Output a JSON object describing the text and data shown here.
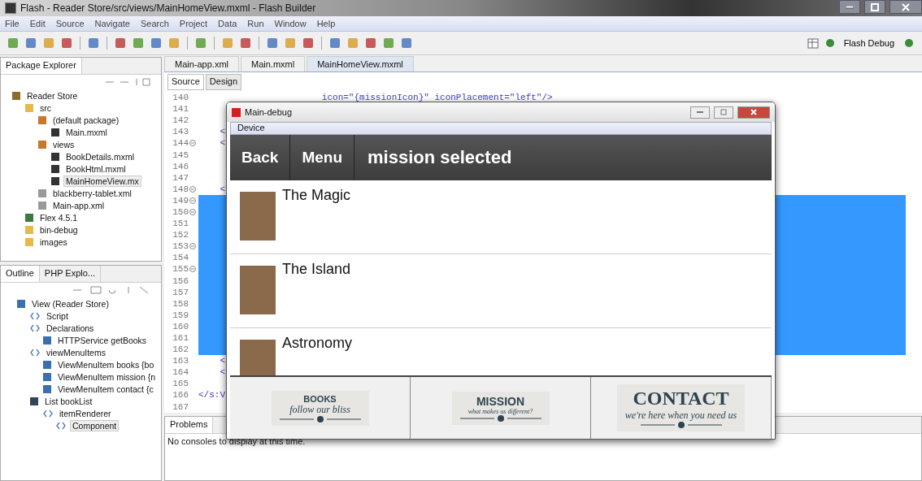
{
  "window": {
    "title": "Flash - Reader Store/src/views/MainHomeView.mxml - Flash Builder"
  },
  "menu": [
    "File",
    "Edit",
    "Source",
    "Navigate",
    "Search",
    "Project",
    "Data",
    "Run",
    "Window",
    "Help"
  ],
  "perspective": {
    "label": "Flash Debug"
  },
  "package_explorer": {
    "title": "Package Explorer",
    "tree": [
      {
        "label": "Reader Store",
        "kind": "project",
        "selected": false,
        "children": [
          {
            "label": "src",
            "kind": "folder",
            "selected": false,
            "children": [
              {
                "label": "(default package)",
                "kind": "package",
                "selected": false,
                "children": [
                  {
                    "label": "Main.mxml",
                    "kind": "mxml",
                    "selected": false
                  }
                ]
              },
              {
                "label": "views",
                "kind": "package",
                "selected": false,
                "children": [
                  {
                    "label": "BookDetails.mxml",
                    "kind": "mxml",
                    "selected": false
                  },
                  {
                    "label": "BookHtml.mxml",
                    "kind": "mxml",
                    "selected": false
                  },
                  {
                    "label": "MainHomeView.mx",
                    "kind": "mxml",
                    "selected": true
                  }
                ]
              },
              {
                "label": "blackberry-tablet.xml",
                "kind": "xml",
                "selected": false
              },
              {
                "label": "Main-app.xml",
                "kind": "xml",
                "selected": false
              }
            ]
          },
          {
            "label": "Flex 4.5.1",
            "kind": "library",
            "selected": false
          },
          {
            "label": "bin-debug",
            "kind": "folder",
            "selected": false
          },
          {
            "label": "images",
            "kind": "folder",
            "selected": false
          }
        ]
      }
    ]
  },
  "outline": {
    "tabs": [
      {
        "label": "Outline",
        "selected": true
      },
      {
        "label": "PHP Explo...",
        "selected": false
      }
    ],
    "tree": [
      {
        "label": "View (Reader Store)",
        "kind": "component",
        "selected": false,
        "children": [
          {
            "label": "Script",
            "kind": "tag",
            "selected": false
          },
          {
            "label": "Declarations",
            "kind": "tag",
            "selected": false,
            "children": [
              {
                "label": "HTTPService getBooks",
                "kind": "component",
                "selected": false
              }
            ]
          },
          {
            "label": "viewMenuItems",
            "kind": "tag",
            "selected": false,
            "children": [
              {
                "label": "ViewMenuItem books {bo",
                "kind": "component",
                "selected": false
              },
              {
                "label": "ViewMenuItem mission {n",
                "kind": "component",
                "selected": false
              },
              {
                "label": "ViewMenuItem contact {c",
                "kind": "component",
                "selected": false
              }
            ]
          },
          {
            "label": "List bookList",
            "kind": "list",
            "selected": false,
            "children": [
              {
                "label": "itemRenderer",
                "kind": "tag",
                "selected": false,
                "children": [
                  {
                    "label": "Component",
                    "kind": "tag",
                    "selected": true
                  }
                ]
              }
            ]
          }
        ]
      }
    ]
  },
  "editor": {
    "tabs": [
      {
        "label": "Main-app.xml",
        "selected": false
      },
      {
        "label": "Main.mxml",
        "selected": false
      },
      {
        "label": "MainHomeView.mxml",
        "selected": true
      }
    ],
    "modes": [
      {
        "label": "Source",
        "selected": true
      },
      {
        "label": "Design",
        "selected": false
      }
    ],
    "lines": [
      {
        "number": "140",
        "code": "                       icon=\"{missionIcon}\" iconPlacement=\"left\"/>",
        "fold": false,
        "selected": false
      },
      {
        "number": "141",
        "fold": false,
        "selected": false
      },
      {
        "number": "142",
        "fold": false,
        "selected": false
      },
      {
        "number": "143",
        "code": "    <",
        "fold": false,
        "selected": false
      },
      {
        "number": "144",
        "code": "    <",
        "fold": true,
        "selected": false
      },
      {
        "number": "145",
        "fold": false,
        "selected": false
      },
      {
        "number": "146",
        "fold": false,
        "selected": false
      },
      {
        "number": "147",
        "fold": false,
        "selected": false
      },
      {
        "number": "148",
        "code": "    <",
        "fold": true,
        "selected": false
      },
      {
        "number": "149",
        "fold": true,
        "selected": true
      },
      {
        "number": "150",
        "fold": true,
        "selected": true
      },
      {
        "number": "151",
        "fold": false,
        "selected": true
      },
      {
        "number": "152",
        "fold": false,
        "selected": true
      },
      {
        "number": "153",
        "fold": true,
        "selected": true
      },
      {
        "number": "154",
        "fold": false,
        "selected": true
      },
      {
        "number": "155",
        "fold": true,
        "selected": true
      },
      {
        "number": "156",
        "fold": false,
        "selected": true
      },
      {
        "number": "157",
        "fold": false,
        "selected": true
      },
      {
        "number": "158",
        "fold": false,
        "selected": true
      },
      {
        "number": "159",
        "fold": false,
        "selected": true
      },
      {
        "number": "160",
        "fold": false,
        "selected": true
      },
      {
        "number": "161",
        "fold": false,
        "selected": true
      },
      {
        "number": "162",
        "fold": false,
        "selected": true
      },
      {
        "number": "163",
        "code": "    <",
        "fold": false,
        "selected": false
      },
      {
        "number": "164",
        "code": "    <",
        "fold": false,
        "selected": false
      },
      {
        "number": "165",
        "fold": false,
        "selected": false
      },
      {
        "number": "166",
        "code": "</s:V",
        "fold": false,
        "selected": false
      },
      {
        "number": "167",
        "fold": false,
        "selected": false
      }
    ]
  },
  "console": {
    "tab": "Problems",
    "message": "No consoles to display at this time."
  },
  "app_window": {
    "title": "Main-debug",
    "menu": "Device",
    "actions": [
      "Back",
      "Menu"
    ],
    "heading": "mission selected",
    "books": [
      {
        "title": "The Magic"
      },
      {
        "title": "The Island"
      },
      {
        "title": "Astronomy"
      }
    ],
    "nav": [
      {
        "title": "BOOKS",
        "tagline": "follow our bliss"
      },
      {
        "title": "MISSION",
        "tagline": "what makes us different?"
      },
      {
        "title": "CONTACT",
        "tagline": "we're here when you need us"
      }
    ]
  }
}
